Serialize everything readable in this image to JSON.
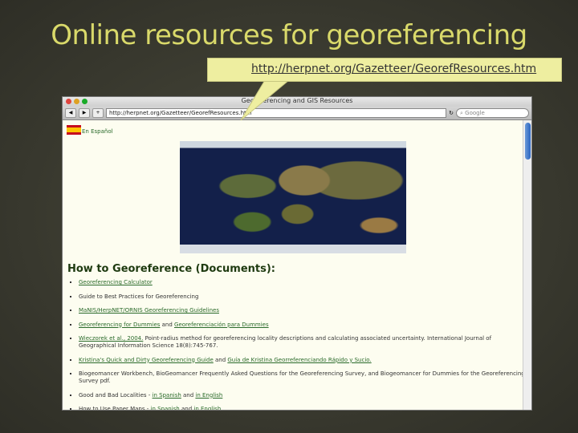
{
  "slide": {
    "title": "Online resources for georeferencing",
    "callout_url": "http://herpnet.org/Gazetteer/GeorefResources.htm"
  },
  "browser": {
    "window_title": "Georeferencing and GIS Resources",
    "url": "http://herpnet.org/Gazetteer/GeorefResources.htm",
    "search_placeholder": "Google"
  },
  "page": {
    "spanish_link": "En Español",
    "heading": "How to Georeference (Documents):",
    "items": [
      {
        "link1": "Georeferencing Calculator"
      },
      {
        "text": "Guide to Best Practices for Georeferencing"
      },
      {
        "link1": "MaNIS/HerpNET/ORNIS Georeferencing Guidelines"
      },
      {
        "link1": "Georeferencing for Dummies",
        "and": " and ",
        "link2": "Georeferenciación para Dummies"
      },
      {
        "link1": "Wieczorek et al., 2004.",
        "text": " Point-radius method for georeferencing locality descriptions and calculating associated uncertainty. International Journal of Geographical Information Science 18(8):745-767."
      },
      {
        "link1": "Kristina's Quick and Dirty Georeferencing Guide",
        "and": " and ",
        "link2": "Guía de Kristina Georreferenciando Rápido y Sucio."
      },
      {
        "text": "Biogeomancer Workbench, BioGeomancer Frequently Asked Questions for the Georeferencing Survey, and Biogeomancer for Dummies for the Georeferencing Survey pdf."
      },
      {
        "text": "Good and Bad Localities - ",
        "link1": "in Spanish",
        "and": " and ",
        "link2": "in English"
      },
      {
        "text": "How to Use Paper Maps - ",
        "link1": "in Spanish",
        "and": " and ",
        "link2": "in English"
      }
    ]
  }
}
